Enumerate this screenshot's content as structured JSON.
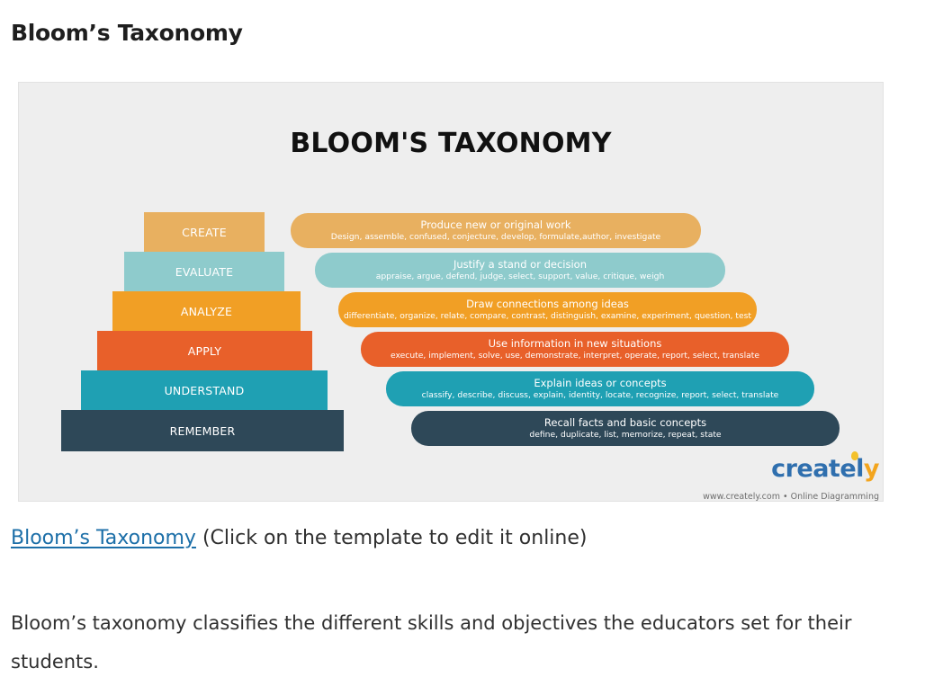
{
  "heading": "Bloom’s Taxonomy",
  "diagram": {
    "title": "BLOOM'S TAXONOMY",
    "levels": [
      {
        "label": "CREATE",
        "color": "#e8b060"
      },
      {
        "label": "EVALUATE",
        "color": "#8ecbcc"
      },
      {
        "label": "ANALYZE",
        "color": "#f19f25"
      },
      {
        "label": "APPLY",
        "color": "#e8602a"
      },
      {
        "label": "UNDERSTAND",
        "color": "#1fa0b3"
      },
      {
        "label": "REMEMBER",
        "color": "#2e4858"
      }
    ],
    "descriptions": [
      {
        "title": "Produce new or original work",
        "verbs": "Design, assemble, confused, conjecture, develop, formulate,author, investigate"
      },
      {
        "title": "Justify a stand or decision",
        "verbs": "appraise, argue, defend, judge, select, support, value, critique, weigh"
      },
      {
        "title": "Draw connections among ideas",
        "verbs": "differentiate, organize, relate, compare, contrast, distinguish, examine, experiment, question, test"
      },
      {
        "title": "Use information in new situations",
        "verbs": "execute, implement, solve, use, demonstrate, interpret, operate, report, select, translate"
      },
      {
        "title": "Explain ideas or concepts",
        "verbs": "classify, describe, discuss, explain, identity, locate, recognize, report, select, translate"
      },
      {
        "title": "Recall facts and basic concepts",
        "verbs": "define, duplicate, list, memorize, repeat, state"
      }
    ],
    "logo": {
      "main": "createl",
      "accent": "y"
    },
    "logo_caption": "www.creately.com • Online Diagramming"
  },
  "link": {
    "text": "Bloom’s Taxonomy",
    "suffix": " (Click on the template to edit it online)"
  },
  "paragraph": "Bloom’s taxonomy classifies the different skills and objectives the educators set for their students."
}
